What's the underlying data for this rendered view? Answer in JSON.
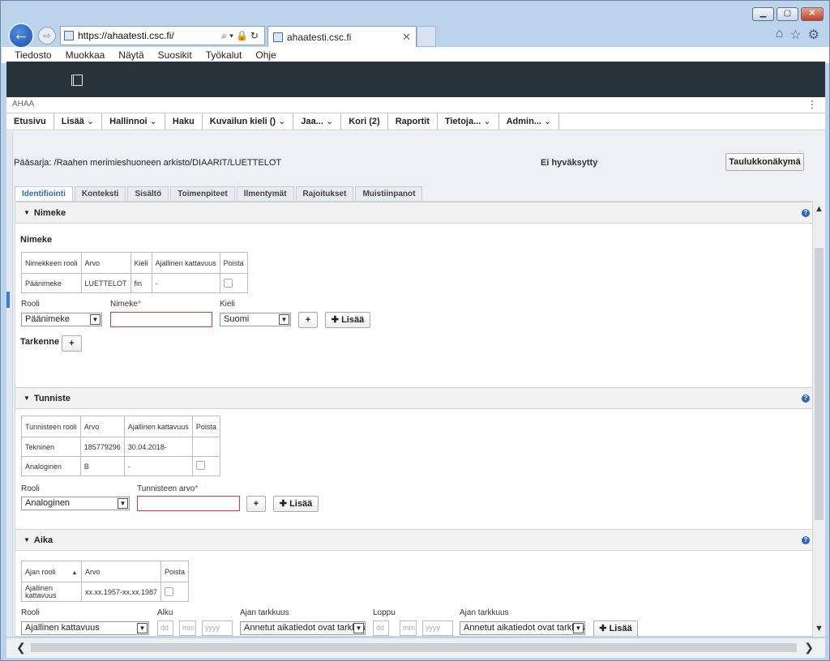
{
  "browser": {
    "url_prefix": "https://",
    "url_host": "ahaatesti.csc.fi/",
    "tab_title": "ahaatesti.csc.fi",
    "menu": [
      "Tiedosto",
      "Muokkaa",
      "Näytä",
      "Suosikit",
      "Työkalut",
      "Ohje"
    ]
  },
  "app": {
    "name": "AHAA",
    "nav": [
      {
        "label": "Etusivu",
        "dropdown": false
      },
      {
        "label": "Lisää",
        "dropdown": true
      },
      {
        "label": "Hallinnoi",
        "dropdown": true
      },
      {
        "label": "Haku",
        "dropdown": false
      },
      {
        "label": "Kuvailun kieli ()",
        "dropdown": true
      },
      {
        "label": "Jaa...",
        "dropdown": true
      },
      {
        "label": "Kori (2)",
        "dropdown": false
      },
      {
        "label": "Raportit",
        "dropdown": false
      },
      {
        "label": "Tietoja...",
        "dropdown": true
      },
      {
        "label": "Admin...",
        "dropdown": true
      }
    ]
  },
  "page": {
    "breadcrumb": "Pääsarja: /Raahen merimieshuoneen arkisto/DIAARIT/LUETTELOT",
    "status": "Ei hyväksytty",
    "table_view_button": "Taulukkonäkymä",
    "tabs": [
      "Identifiointi",
      "Konteksti",
      "Sisältö",
      "Toimenpiteet",
      "Ilmentymät",
      "Rajoitukset",
      "Muistiinpanot"
    ],
    "active_tab": 0
  },
  "nimeke": {
    "section_title": "Nimeke",
    "subtitle": "Nimeke",
    "columns": [
      "Nimekkeen rooli",
      "Arvo",
      "Kieli",
      "Ajallinen kattavuus",
      "Poista"
    ],
    "rows": [
      [
        "Päänimeke",
        "LUETTELOT",
        "fin",
        "-"
      ]
    ],
    "rooli_label": "Rooli",
    "rooli_value": "Päänimeke",
    "nimeke_label": "Nimeke",
    "kieli_label": "Kieli",
    "kieli_value": "Suomi",
    "plus": "+",
    "add_button": "Lisää",
    "tarkenne_label": "Tarkenne"
  },
  "tunniste": {
    "section_title": "Tunniste",
    "columns": [
      "Tunnisteen rooli",
      "Arvo",
      "Ajallinen kattavuus",
      "Poista"
    ],
    "rows": [
      [
        "Tekninen",
        "185779296",
        "30.04.2018-"
      ],
      [
        "Analoginen",
        "B",
        "-"
      ]
    ],
    "rooli_label": "Rooli",
    "rooli_value": "Analoginen",
    "arvo_label": "Tunnisteen arvo",
    "plus": "+",
    "add_button": "Lisää"
  },
  "aika": {
    "section_title": "Aika",
    "columns": [
      "Ajan rooli",
      "Arvo",
      "Poista"
    ],
    "rows": [
      [
        "Ajallinen kattavuus",
        "xx.xx.1957-xx.xx.1987"
      ]
    ],
    "rooli_label": "Rooli",
    "rooli_value": "Ajallinen kattavuus",
    "alku_label": "Alku",
    "tarkkuus_label": "Ajan tarkkuus",
    "loppu_label": "Loppu",
    "tarkkuus_label2": "Ajan tarkkuus",
    "dd": "dd",
    "mm": "mm",
    "yyyy": "yyyy",
    "tarkkuus_value": "Annetut aikatiedot ovat tarkkoja",
    "add_button": "Lisää"
  }
}
